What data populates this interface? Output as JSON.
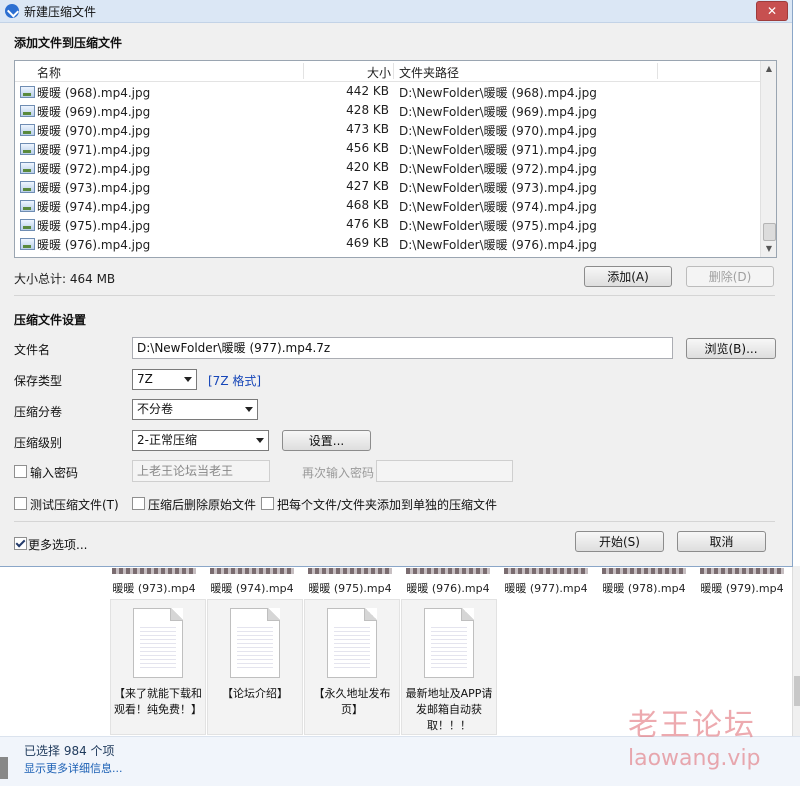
{
  "dialog": {
    "title": "新建压缩文件",
    "close_label": "✕",
    "add_section_title": "添加文件到压缩文件",
    "list": {
      "columns": {
        "name": "名称",
        "size": "大小",
        "path": "文件夹路径"
      },
      "rows": [
        {
          "name": "暖暖 (968).mp4.jpg",
          "size": "442 KB",
          "path": "D:\\NewFolder\\暖暖 (968).mp4.jpg"
        },
        {
          "name": "暖暖 (969).mp4.jpg",
          "size": "428 KB",
          "path": "D:\\NewFolder\\暖暖 (969).mp4.jpg"
        },
        {
          "name": "暖暖 (970).mp4.jpg",
          "size": "473 KB",
          "path": "D:\\NewFolder\\暖暖 (970).mp4.jpg"
        },
        {
          "name": "暖暖 (971).mp4.jpg",
          "size": "456 KB",
          "path": "D:\\NewFolder\\暖暖 (971).mp4.jpg"
        },
        {
          "name": "暖暖 (972).mp4.jpg",
          "size": "420 KB",
          "path": "D:\\NewFolder\\暖暖 (972).mp4.jpg"
        },
        {
          "name": "暖暖 (973).mp4.jpg",
          "size": "427 KB",
          "path": "D:\\NewFolder\\暖暖 (973).mp4.jpg"
        },
        {
          "name": "暖暖 (974).mp4.jpg",
          "size": "468 KB",
          "path": "D:\\NewFolder\\暖暖 (974).mp4.jpg"
        },
        {
          "name": "暖暖 (975).mp4.jpg",
          "size": "476 KB",
          "path": "D:\\NewFolder\\暖暖 (975).mp4.jpg"
        },
        {
          "name": "暖暖 (976).mp4.jpg",
          "size": "469 KB",
          "path": "D:\\NewFolder\\暖暖 (976).mp4.jpg"
        }
      ]
    },
    "total_size": "大小总计: 464 MB",
    "add_button": "添加(A)",
    "delete_button": "删除(D)",
    "settings_section_title": "压缩文件设置",
    "filename_label": "文件名",
    "filename_value": "D:\\NewFolder\\暖暖 (977).mp4.7z",
    "browse_button": "浏览(B)...",
    "save_type_label": "保存类型",
    "save_type_value": "7Z",
    "format_link": "[7Z 格式]",
    "split_label": "压缩分卷",
    "split_value": "不分卷",
    "level_label": "压缩级别",
    "level_value": "2-正常压缩",
    "settings_button": "设置...",
    "password_label": "输入密码",
    "password_value": "上老王论坛当老王",
    "reenter_label": "再次输入密码",
    "reenter_value": "",
    "test_label": "测试压缩文件(T)",
    "delete_after_label": "压缩后删除原始文件",
    "each_separate_label": "把每个文件/文件夹添加到单独的压缩文件",
    "more_options_label": "更多选项...",
    "start_button": "开始(S)",
    "cancel_button": "取消"
  },
  "explorer": {
    "thumbnails": [
      "暖暖 (973).mp4",
      "暖暖 (974).mp4",
      "暖暖 (975).mp4",
      "暖暖 (976).mp4",
      "暖暖 (977).mp4",
      "暖暖 (978).mp4",
      "暖暖 (979).mp4"
    ],
    "files": [
      "【来了就能下载和观看！纯免费！】",
      "【论坛介绍】",
      "【永久地址发布页】",
      "最新地址及APP请发邮箱自动获取！！！"
    ],
    "status_count": "已选择 984 个项",
    "status_more": "显示更多详细信息..."
  },
  "watermark": {
    "cn": "老王论坛",
    "url": "laowang.vip"
  }
}
